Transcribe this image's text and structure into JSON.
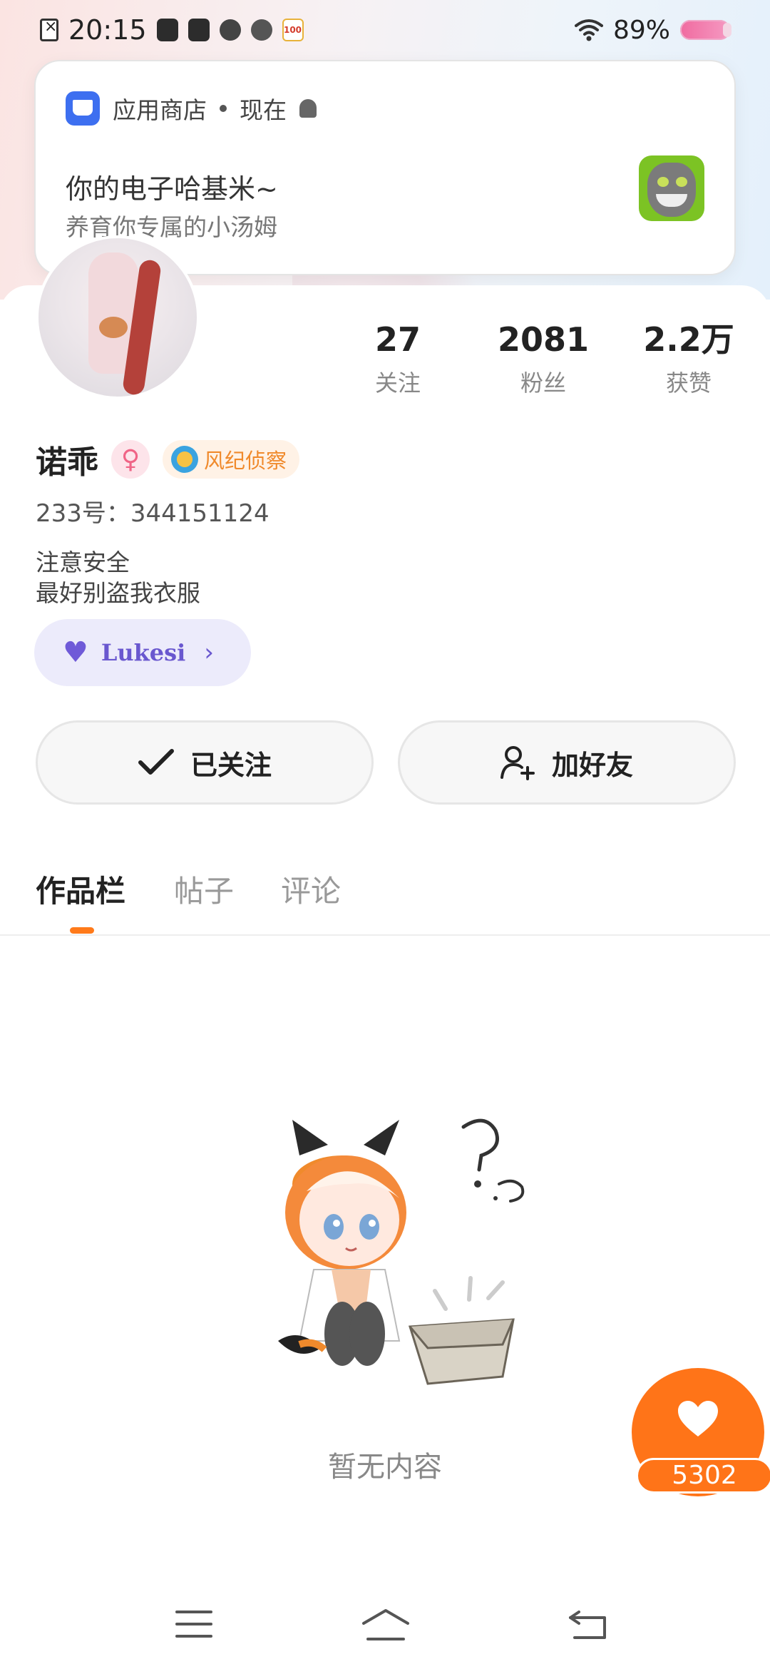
{
  "status_bar": {
    "time": "20:15",
    "battery": "89%"
  },
  "notification": {
    "app_name": "应用商店",
    "separator": "•",
    "time": "现在",
    "title": "你的电子哈基米~",
    "body": "养育你专属的小汤姆"
  },
  "profile": {
    "stats": [
      {
        "value": "27",
        "label": "关注"
      },
      {
        "value": "2081",
        "label": "粉丝"
      },
      {
        "value": "2.2万",
        "label": "获赞"
      }
    ],
    "name": "诺乖",
    "title_badge": "风纪侦察",
    "uid": "233号：344151124",
    "bio_lines": [
      "注意安全",
      "最好别盗我衣服"
    ],
    "guild_tag": "Lukesi"
  },
  "actions": {
    "follow_label": "已关注",
    "add_friend_label": "加好友"
  },
  "tabs": [
    "作品栏",
    "帖子",
    "评论"
  ],
  "active_tab": "作品栏",
  "empty_state": {
    "text": "暂无内容"
  },
  "like_fab": {
    "count": "5302"
  },
  "colors": {
    "accent": "#ff7418",
    "guild": "#6957cf",
    "badge": "#f08a2c"
  }
}
